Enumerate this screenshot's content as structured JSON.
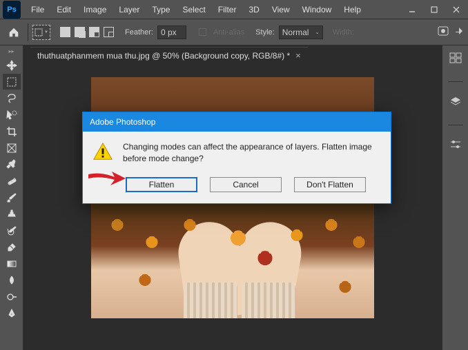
{
  "app": {
    "logo_text": "Ps"
  },
  "menu": [
    "File",
    "Edit",
    "Image",
    "Layer",
    "Type",
    "Select",
    "Filter",
    "3D",
    "View",
    "Window",
    "Help"
  ],
  "options": {
    "feather_label": "Feather:",
    "feather_value": "0 px",
    "antialias_label": "Anti-alias",
    "style_label": "Style:",
    "style_value": "Normal",
    "width_label": "Width:"
  },
  "document": {
    "tab_title": "thuthuatphanmem mua thu.jpg @ 50% (Background copy, RGB/8#) *",
    "close": "×"
  },
  "dialog": {
    "title": "Adobe Photoshop",
    "message": "Changing modes can affect the appearance of layers.  Flatten image before mode change?",
    "flatten": "Flatten",
    "cancel": "Cancel",
    "dont_flatten": "Don't Flatten"
  }
}
